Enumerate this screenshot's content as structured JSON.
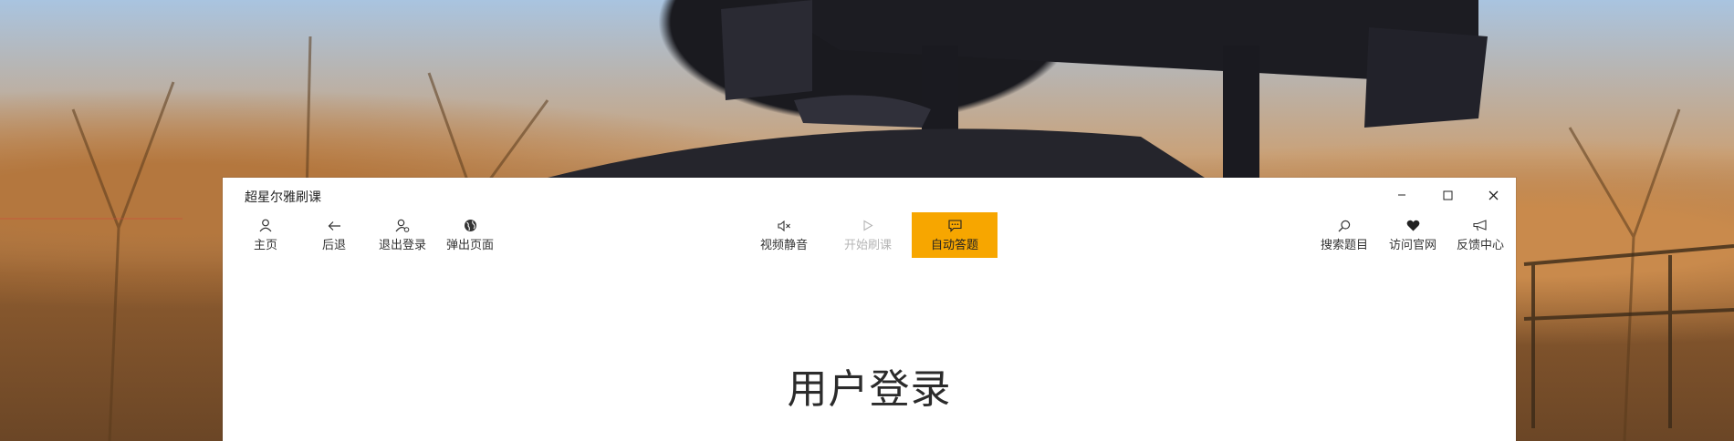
{
  "app": {
    "title": "超星尔雅刷课"
  },
  "window_controls": {
    "minimize": "−",
    "maximize": "☐",
    "close": "✕"
  },
  "toolbar": {
    "left": [
      {
        "label": "主页",
        "icon": "user-icon"
      },
      {
        "label": "后退",
        "icon": "arrow-left-icon"
      },
      {
        "label": "退出登录",
        "icon": "user-logout-icon"
      },
      {
        "label": "弹出页面",
        "icon": "globe-icon"
      }
    ],
    "center": [
      {
        "label": "视频静音",
        "icon": "mute-icon",
        "state": "normal"
      },
      {
        "label": "开始刷课",
        "icon": "play-icon",
        "state": "disabled"
      },
      {
        "label": "自动答题",
        "icon": "chat-icon",
        "state": "active"
      }
    ],
    "right": [
      {
        "label": "搜索题目",
        "icon": "search-icon"
      },
      {
        "label": "访问官网",
        "icon": "heart-icon"
      },
      {
        "label": "反馈中心",
        "icon": "megaphone-icon"
      }
    ]
  },
  "main": {
    "heading": "用户登录"
  },
  "colors": {
    "accent": "#f7a600",
    "disabled_text": "#b5b5b5",
    "text": "#333333"
  }
}
